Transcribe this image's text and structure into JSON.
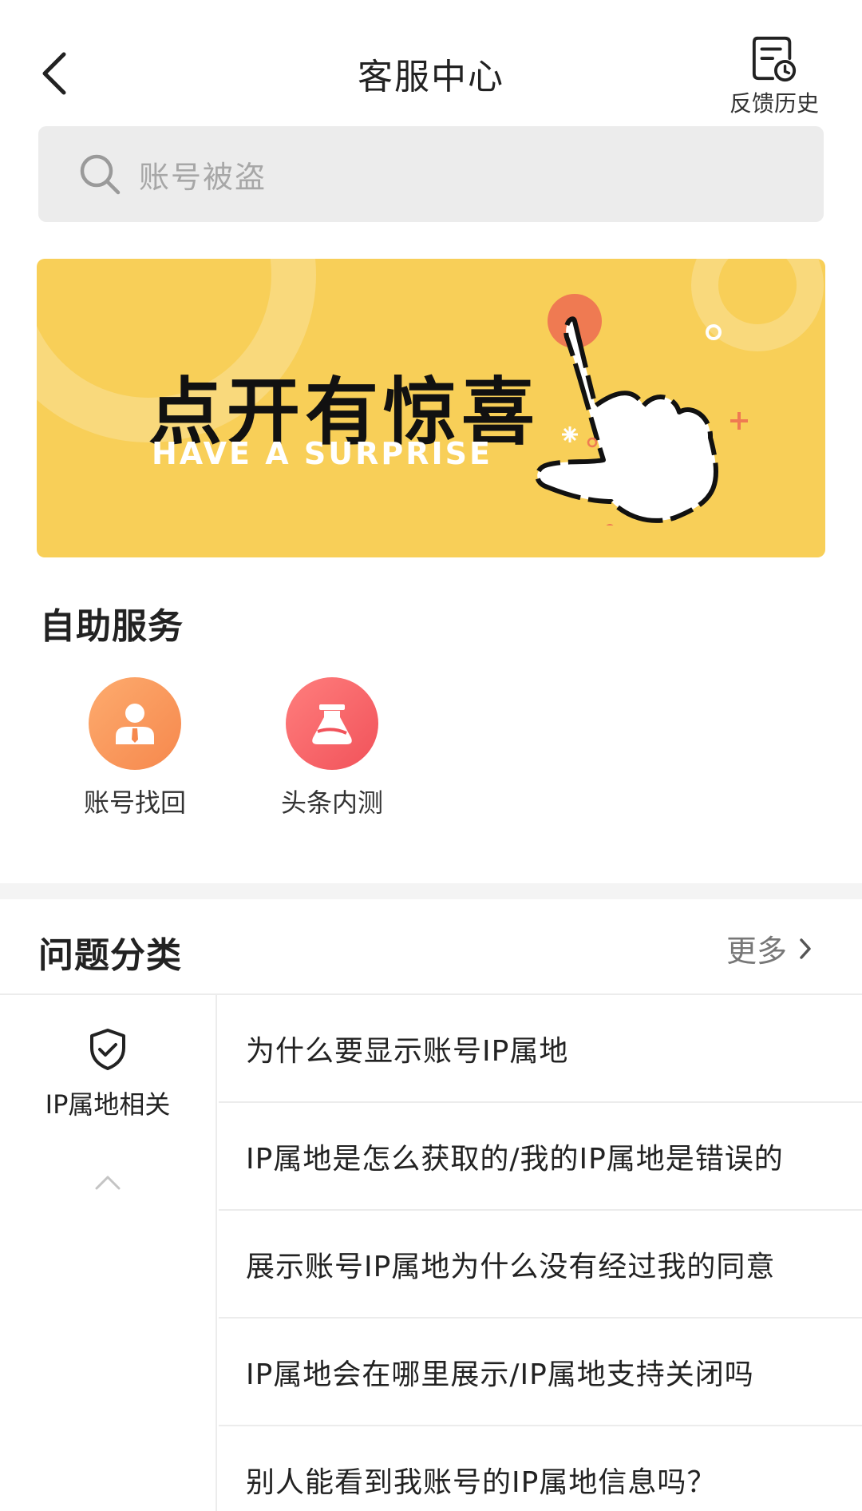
{
  "header": {
    "title": "客服中心",
    "history_label": "反馈历史"
  },
  "search": {
    "placeholder": "账号被盗"
  },
  "banner": {
    "title_cn": "点开有惊喜",
    "title_en": "HAVE A SURPRISE",
    "bg_color": "#f8cf58"
  },
  "self_service": {
    "title": "自助服务",
    "items": [
      {
        "label": "账号找回",
        "icon": "person-icon",
        "color": "#f98a4f"
      },
      {
        "label": "头条内测",
        "icon": "flask-icon",
        "color": "#f5565d"
      }
    ]
  },
  "categories": {
    "title": "问题分类",
    "more_label": "更多",
    "active_category": {
      "label": "IP属地相关",
      "icon": "shield-check-icon"
    },
    "questions": [
      "为什么要显示账号IP属地",
      "IP属地是怎么获取的/我的IP属地是错误的",
      "展示账号IP属地为什么没有经过我的同意",
      "IP属地会在哪里展示/IP属地支持关闭吗",
      "别人能看到我账号的IP属地信息吗？"
    ]
  }
}
